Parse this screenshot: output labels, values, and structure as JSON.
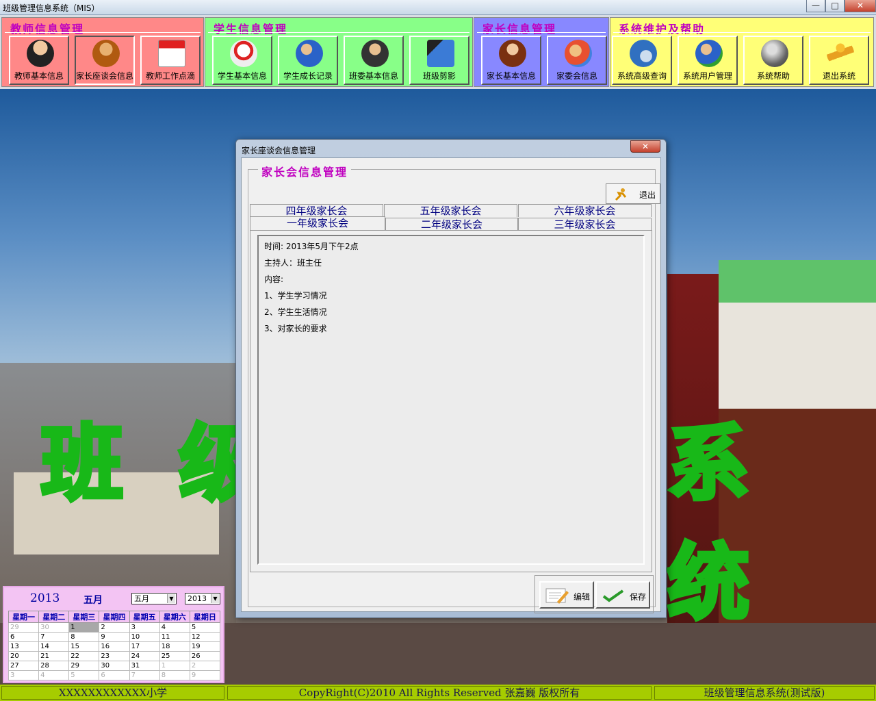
{
  "window": {
    "title": "班级管理信息系统（MIS）",
    "min": "—",
    "max": "□",
    "close": "✕"
  },
  "toolbar": {
    "groups": [
      {
        "label": "教师信息管理",
        "buttons": [
          "教师基本信息",
          "家长座谈会信息",
          "教师工作点滴"
        ],
        "color": "#ff8888"
      },
      {
        "label": "学生信息管理",
        "buttons": [
          "学生基本信息",
          "学生成长记录",
          "班委基本信息",
          "班级剪影"
        ],
        "color": "#88ff88"
      },
      {
        "label": "家长信息管理",
        "buttons": [
          "家长基本信息",
          "家委会信息"
        ],
        "color": "#8888ff"
      },
      {
        "label": "系统维护及帮助",
        "buttons": [
          "系统高级查询",
          "系统用户管理",
          "系统帮助",
          "退出系统"
        ],
        "color": "#ffff77"
      }
    ]
  },
  "background": {
    "banner_left": "班 级",
    "banner_right": "系 统"
  },
  "dialog": {
    "title": "家长座谈会信息管理",
    "close": "✕",
    "frame_title": "家长会信息管理",
    "exit_label": "退出",
    "tabs_row1": [
      "四年级家长会",
      "五年级家长会",
      "六年级家长会"
    ],
    "tabs_row2": [
      "一年级家长会",
      "二年级家长会",
      "三年级家长会"
    ],
    "active_tab": "一年级家长会",
    "content_lines": [
      "时间:  2013年5月下午2点",
      "主持人：班主任",
      "内容:",
      "1、学生学习情况",
      "2、学生生活情况",
      "3、对家长的要求"
    ],
    "edit_label": "编辑",
    "save_label": "保存"
  },
  "calendar": {
    "year": "2013",
    "month": "五月",
    "month_select": "五月",
    "year_select": "2013",
    "weekdays": [
      "星期一",
      "星期二",
      "星期三",
      "星期四",
      "星期五",
      "星期六",
      "星期日"
    ],
    "weeks": [
      [
        "29",
        "30",
        "1",
        "2",
        "3",
        "4",
        "5"
      ],
      [
        "6",
        "7",
        "8",
        "9",
        "10",
        "11",
        "12"
      ],
      [
        "13",
        "14",
        "15",
        "16",
        "17",
        "18",
        "19"
      ],
      [
        "20",
        "21",
        "22",
        "23",
        "24",
        "25",
        "26"
      ],
      [
        "27",
        "28",
        "29",
        "30",
        "31",
        "1",
        "2"
      ],
      [
        "3",
        "4",
        "5",
        "6",
        "7",
        "8",
        "9"
      ]
    ],
    "today": "1"
  },
  "statusbar": {
    "school": "XXXXXXXXXXXX小学",
    "copyright": "CopyRight(C)2010  All Rights Reserved 张嘉巍  版权所有",
    "app": "班级管理信息系统(测试版)"
  }
}
